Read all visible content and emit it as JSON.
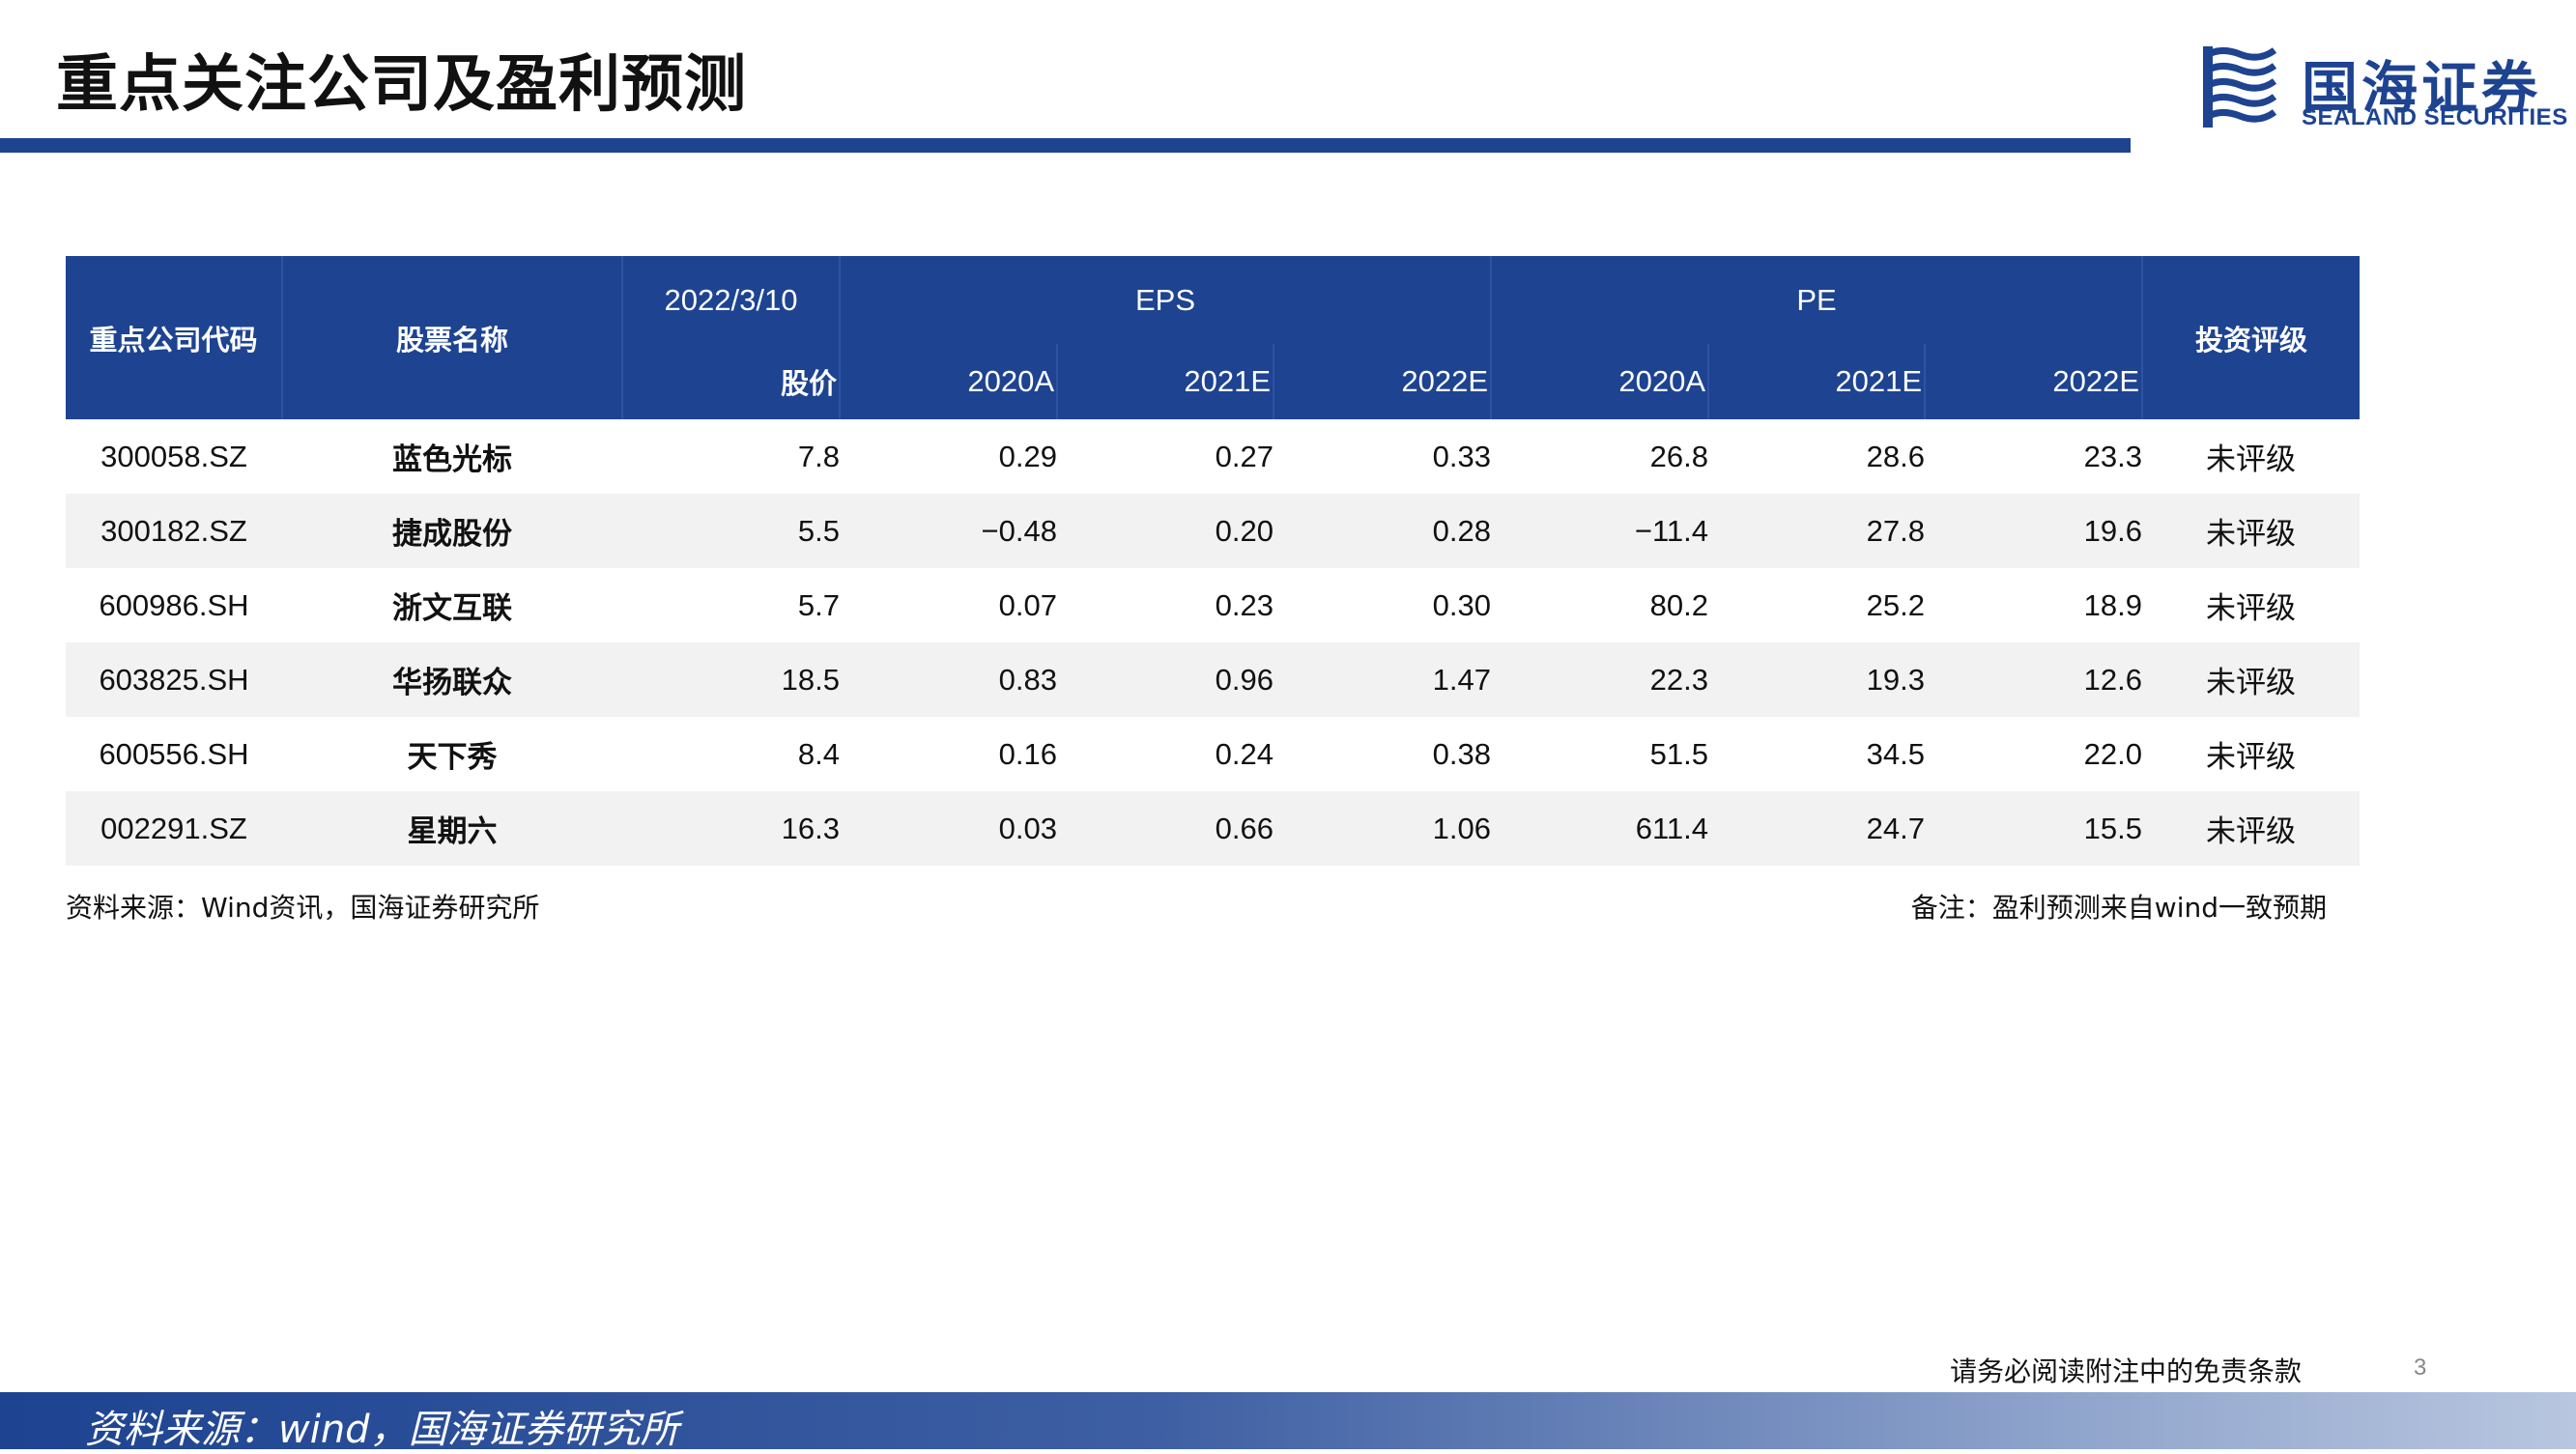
{
  "header": {
    "title": "重点关注公司及盈利预测",
    "logo_cn": "国海证券",
    "logo_en": "SEALAND SECURITIES",
    "accent_color": "#1d4391"
  },
  "table": {
    "headers": {
      "code": "重点公司代码",
      "name": "股票名称",
      "date": "2022/3/10",
      "price": "股价",
      "eps": "EPS",
      "pe": "PE",
      "rating": "投资评级",
      "years": [
        "2020A",
        "2021E",
        "2022E"
      ]
    },
    "rows": [
      {
        "code": "300058.SZ",
        "name": "蓝色光标",
        "price": "7.8",
        "eps": [
          "0.29",
          "0.27",
          "0.33"
        ],
        "pe": [
          "26.8",
          "28.6",
          "23.3"
        ],
        "rating": "未评级"
      },
      {
        "code": "300182.SZ",
        "name": "捷成股份",
        "price": "5.5",
        "eps": [
          "−0.48",
          "0.20",
          "0.28"
        ],
        "pe": [
          "−11.4",
          "27.8",
          "19.6"
        ],
        "rating": "未评级"
      },
      {
        "code": "600986.SH",
        "name": "浙文互联",
        "price": "5.7",
        "eps": [
          "0.07",
          "0.23",
          "0.30"
        ],
        "pe": [
          "80.2",
          "25.2",
          "18.9"
        ],
        "rating": "未评级"
      },
      {
        "code": "603825.SH",
        "name": "华扬联众",
        "price": "18.5",
        "eps": [
          "0.83",
          "0.96",
          "1.47"
        ],
        "pe": [
          "22.3",
          "19.3",
          "12.6"
        ],
        "rating": "未评级"
      },
      {
        "code": "600556.SH",
        "name": "天下秀",
        "price": "8.4",
        "eps": [
          "0.16",
          "0.24",
          "0.38"
        ],
        "pe": [
          "51.5",
          "34.5",
          "22.0"
        ],
        "rating": "未评级"
      },
      {
        "code": "002291.SZ",
        "name": "星期六",
        "price": "16.3",
        "eps": [
          "0.03",
          "0.66",
          "1.06"
        ],
        "pe": [
          "611.4",
          "24.7",
          "15.5"
        ],
        "rating": "未评级"
      }
    ]
  },
  "notes": {
    "source": "资料来源：Wind资讯，国海证券研究所",
    "remark": "备注：盈利预测来自wind一致预期"
  },
  "footer": {
    "disclaimer": "请务必阅读附注中的免责条款",
    "page_number": "3",
    "source": "资料来源：wind，国海证券研究所"
  }
}
